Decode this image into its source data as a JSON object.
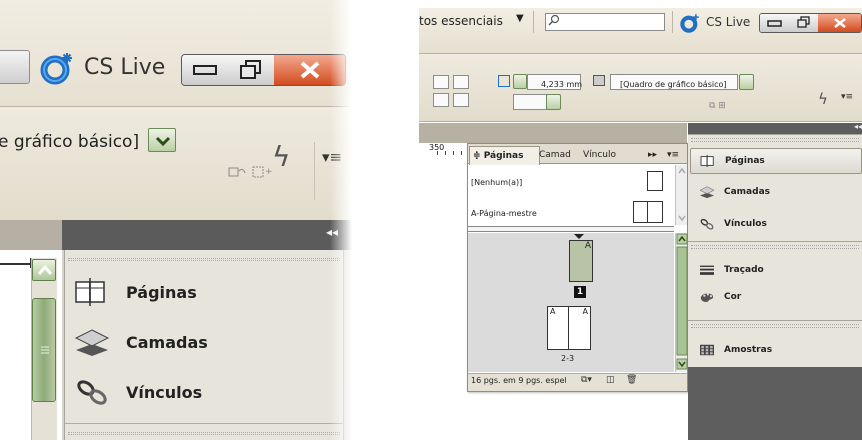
{
  "app": {
    "cs_live_label": "CS Live",
    "workspace_label": "tos essenciais",
    "frame_style": "e gráfico básico]",
    "frame_style_full": "[Quadro de gráfico básico]",
    "stroke_value": "4,233 mm",
    "ruler_number": "350"
  },
  "dock": {
    "items": [
      {
        "label": "Páginas",
        "icon": "pages-icon"
      },
      {
        "label": "Camadas",
        "icon": "layers-icon"
      },
      {
        "label": "Vínculos",
        "icon": "links-icon"
      },
      {
        "label": "Traçado",
        "icon": "stroke-icon"
      },
      {
        "label": "Cor",
        "icon": "color-icon"
      },
      {
        "label": "Amostras",
        "icon": "swatches-icon"
      }
    ],
    "collapse_glyph": "◂◂"
  },
  "pages_panel": {
    "tabs": [
      {
        "label": "Páginas"
      },
      {
        "label": "Camad"
      },
      {
        "label": "Vínculo"
      }
    ],
    "tab_prefix": "≑",
    "masters": [
      {
        "label": "[Nenhum(a)]"
      },
      {
        "label": "A-Página-mestre"
      }
    ],
    "page1_number": "1",
    "page1_master": "A",
    "spread_masters": [
      "A",
      "A"
    ],
    "spread_label": "2-3",
    "footer_text": "16 pgs. em 9 pgs. espel",
    "fast_forward": "▸▸",
    "menu": "▾≡"
  }
}
